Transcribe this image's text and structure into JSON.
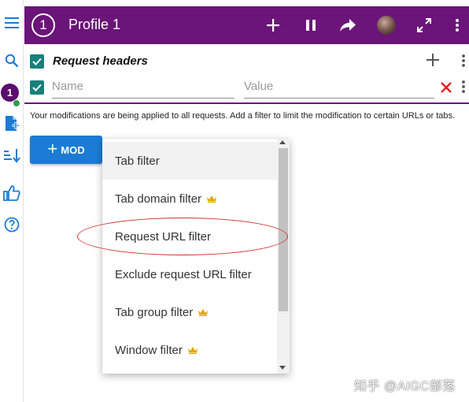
{
  "header": {
    "profile_number": "1",
    "title": "Profile 1"
  },
  "rail": {
    "icons": [
      "menu-icon",
      "search-icon",
      "profile-badge",
      "add-file-icon",
      "sort-icon",
      "thumbs-up-icon",
      "help-icon"
    ],
    "badge_number": "1"
  },
  "request_headers": {
    "title": "Request headers",
    "name_placeholder": "Name",
    "value_placeholder": "Value"
  },
  "note": "Your modifications are being applied to all requests. Add a filter to limit the modification to certain URLs or tabs.",
  "mod_button": {
    "plus": "+",
    "label": "MOD"
  },
  "menu": {
    "items": [
      {
        "label": "Tab filter",
        "premium": false
      },
      {
        "label": "Tab domain filter",
        "premium": true
      },
      {
        "label": "Request URL filter",
        "premium": false
      },
      {
        "label": "Exclude request URL filter",
        "premium": false
      },
      {
        "label": "Tab group filter",
        "premium": true
      },
      {
        "label": "Window filter",
        "premium": true
      }
    ]
  },
  "watermark": "知乎 @AIGC部落",
  "colors": {
    "appbar": "#6b1479",
    "checkbox": "#17807a",
    "mod_button": "#1c7bd4",
    "crown": "#e0a800",
    "annotation": "#d6312f"
  }
}
